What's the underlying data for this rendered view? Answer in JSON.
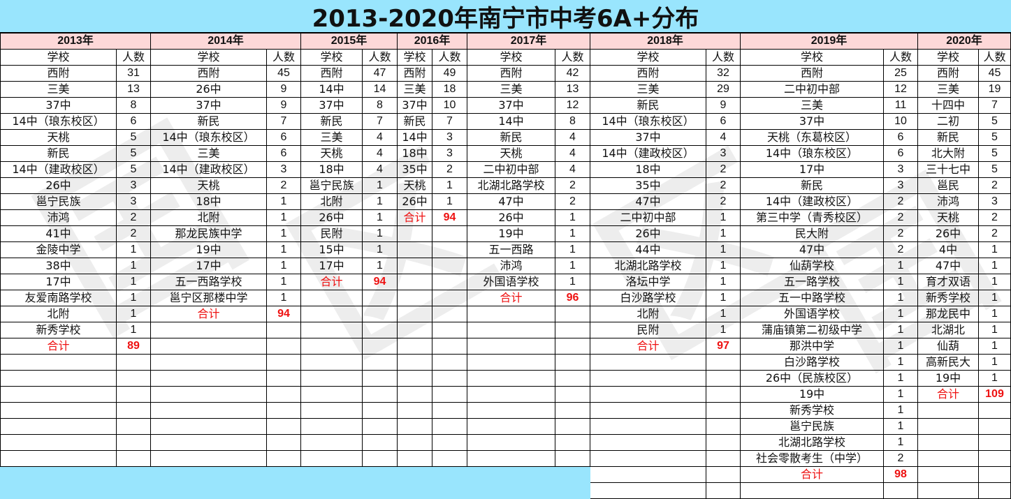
{
  "title": "2013-2020年南宁市中考6A+分布",
  "header": {
    "school_label": "学校",
    "count_label": "人数",
    "total_label": "合计"
  },
  "colors": {
    "title_bg": "#99e5fd",
    "year_bg": "#fdd8d8",
    "total_text": "#ee1111"
  },
  "years": [
    {
      "year": "2013年",
      "rows": [
        [
          "西附",
          "31"
        ],
        [
          "三美",
          "13"
        ],
        [
          "37中",
          "8"
        ],
        [
          "14中（琅东校区）",
          "6"
        ],
        [
          "天桃",
          "5"
        ],
        [
          "新民",
          "5"
        ],
        [
          "14中（建政校区）",
          "5"
        ],
        [
          "26中",
          "3"
        ],
        [
          "邕宁民族",
          "3"
        ],
        [
          "沛鸿",
          "2"
        ],
        [
          "41中",
          "2"
        ],
        [
          "金陵中学",
          "1"
        ],
        [
          "38中",
          "1"
        ],
        [
          "17中",
          "1"
        ],
        [
          "友爱南路学校",
          "1"
        ],
        [
          "北附",
          "1"
        ],
        [
          "新秀学校",
          "1"
        ]
      ],
      "total": "89"
    },
    {
      "year": "2014年",
      "rows": [
        [
          "西附",
          "45"
        ],
        [
          "26中",
          "9"
        ],
        [
          "37中",
          "9"
        ],
        [
          "新民",
          "7"
        ],
        [
          "14中（琅东校区）",
          "6"
        ],
        [
          "三美",
          "6"
        ],
        [
          "14中（建政校区）",
          "3"
        ],
        [
          "天桃",
          "2"
        ],
        [
          "18中",
          "1"
        ],
        [
          "北附",
          "1"
        ],
        [
          "那龙民族中学",
          "1"
        ],
        [
          "19中",
          "1"
        ],
        [
          "17中",
          "1"
        ],
        [
          "五一西路学校",
          "1"
        ],
        [
          "邕宁区那楼中学",
          "1"
        ]
      ],
      "total": "94"
    },
    {
      "year": "2015年",
      "rows": [
        [
          "西附",
          "47"
        ],
        [
          "14中",
          "14"
        ],
        [
          "37中",
          "8"
        ],
        [
          "新民",
          "7"
        ],
        [
          "三美",
          "4"
        ],
        [
          "天桃",
          "4"
        ],
        [
          "18中",
          "4"
        ],
        [
          "邕宁民族",
          "1"
        ],
        [
          "北附",
          "1"
        ],
        [
          "26中",
          "1"
        ],
        [
          "民附",
          "1"
        ],
        [
          "15中",
          "1"
        ],
        [
          "17中",
          "1"
        ]
      ],
      "total": "94"
    },
    {
      "year": "2016年",
      "rows": [
        [
          "西附",
          "49"
        ],
        [
          "三美",
          "18"
        ],
        [
          "37中",
          "10"
        ],
        [
          "新民",
          "7"
        ],
        [
          "14中",
          "3"
        ],
        [
          "18中",
          "3"
        ],
        [
          "35中",
          "2"
        ],
        [
          "天桃",
          "1"
        ],
        [
          "26中",
          "1"
        ]
      ],
      "total": "94"
    },
    {
      "year": "2017年",
      "rows": [
        [
          "西附",
          "42"
        ],
        [
          "三美",
          "13"
        ],
        [
          "37中",
          "12"
        ],
        [
          "14中",
          "8"
        ],
        [
          "新民",
          "4"
        ],
        [
          "天桃",
          "4"
        ],
        [
          "二中初中部",
          "4"
        ],
        [
          "北湖北路学校",
          "2"
        ],
        [
          "47中",
          "2"
        ],
        [
          "26中",
          "1"
        ],
        [
          "19中",
          "1"
        ],
        [
          "五一西路",
          "1"
        ],
        [
          "沛鸿",
          "1"
        ],
        [
          "外国语学校",
          "1"
        ]
      ],
      "total": "96"
    },
    {
      "year": "2018年",
      "rows": [
        [
          "西附",
          "32"
        ],
        [
          "三美",
          "29"
        ],
        [
          "新民",
          "9"
        ],
        [
          "14中（琅东校区）",
          "6"
        ],
        [
          "37中",
          "4"
        ],
        [
          "14中（建政校区）",
          "3"
        ],
        [
          "18中",
          "2"
        ],
        [
          "35中",
          "2"
        ],
        [
          "47中",
          "2"
        ],
        [
          "二中初中部",
          "1"
        ],
        [
          "26中",
          "1"
        ],
        [
          "44中",
          "1"
        ],
        [
          "北湖北路学校",
          "1"
        ],
        [
          "洛坛中学",
          "1"
        ],
        [
          "白沙路学校",
          "1"
        ],
        [
          "北附",
          "1"
        ],
        [
          "民附",
          "1"
        ]
      ],
      "total": "97"
    },
    {
      "year": "2019年",
      "rows": [
        [
          "西附",
          "25"
        ],
        [
          "二中初中部",
          "12"
        ],
        [
          "三美",
          "11"
        ],
        [
          "37中",
          "10"
        ],
        [
          "天桃（东葛校区）",
          "6"
        ],
        [
          "14中（琅东校区）",
          "6"
        ],
        [
          "17中",
          "3"
        ],
        [
          "新民",
          "3"
        ],
        [
          "14中（建政校区）",
          "2"
        ],
        [
          "第三中学（青秀校区）",
          "2"
        ],
        [
          "民大附",
          "2"
        ],
        [
          "47中",
          "2"
        ],
        [
          "仙葫学校",
          "1"
        ],
        [
          "五一路学校",
          "1"
        ],
        [
          "五一中路学校",
          "1"
        ],
        [
          "外国语学校",
          "1"
        ],
        [
          "蒲庙镇第二初级中学",
          "1"
        ],
        [
          "那洪中学",
          "1"
        ],
        [
          "白沙路学校",
          "1"
        ],
        [
          "26中（民族校区）",
          "1"
        ],
        [
          "19中",
          "1"
        ],
        [
          "新秀学校",
          "1"
        ],
        [
          "邕宁民族",
          "1"
        ],
        [
          "北湖北路学校",
          "1"
        ],
        [
          "社会零散考生（中学）",
          "2"
        ]
      ],
      "total": "98"
    },
    {
      "year": "2020年",
      "rows": [
        [
          "西附",
          "45"
        ],
        [
          "三美",
          "19"
        ],
        [
          "十四中",
          "7"
        ],
        [
          "二初",
          "5"
        ],
        [
          "新民",
          "5"
        ],
        [
          "北大附",
          "5"
        ],
        [
          "三十七中",
          "5"
        ],
        [
          "邕民",
          "2"
        ],
        [
          "沛鸿",
          "3"
        ],
        [
          "天桃",
          "2"
        ],
        [
          "26中",
          "2"
        ],
        [
          "4中",
          "1"
        ],
        [
          "47中",
          "1"
        ],
        [
          "育才双语",
          "1"
        ],
        [
          "新秀学校",
          "1"
        ],
        [
          "那龙民中",
          "1"
        ],
        [
          "北湖北",
          "1"
        ],
        [
          "仙葫",
          "1"
        ],
        [
          "高新民大",
          "1"
        ],
        [
          "19中",
          "1"
        ]
      ],
      "total": "109"
    }
  ]
}
